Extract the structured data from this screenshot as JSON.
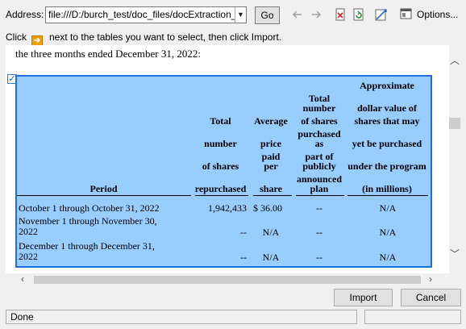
{
  "toolbar": {
    "address_label": "Address:",
    "address_value": "file:///D:/burch_test/doc_files/docExtraction_",
    "go_label": "Go",
    "options_label": "Options..."
  },
  "hint": {
    "before": "Click",
    "after": "next to the tables you want to select, then click Import."
  },
  "document": {
    "intro_text": "the three months ended December 31, 2022:",
    "table": {
      "headers": {
        "period": "Period",
        "total_shares": [
          "Total",
          "number",
          "of shares",
          "repurchased"
        ],
        "avg_price": [
          "Average",
          "price",
          "paid",
          "per",
          "share"
        ],
        "total_plan": [
          "Total",
          "number",
          "of shares",
          "purchased",
          "as",
          "part of",
          "publicly",
          "announced",
          "plan"
        ],
        "approx": [
          "Approximate",
          "dollar value of",
          "shares that may",
          "yet be purchased",
          "under the program",
          "(in millions)"
        ]
      },
      "rows": [
        {
          "period": "October 1 through October 31, 2022",
          "shares": "1,942,433",
          "price": "$ 36.00",
          "plan": "--",
          "approx": "N/A"
        },
        {
          "period_line1": "November 1 through November 30,",
          "period_line2": "2022",
          "shares": "--",
          "price": "N/A",
          "plan": "--",
          "approx": "N/A"
        },
        {
          "period_line1": "December 1 through December 31,",
          "period_line2": "2022",
          "shares": "--",
          "price": "N/A",
          "plan": "--",
          "approx": "N/A"
        }
      ]
    }
  },
  "buttons": {
    "import_label": "Import",
    "cancel_label": "Cancel"
  },
  "status": {
    "text": "Done"
  },
  "colors": {
    "table_selected_bg": "#99ccff",
    "table_selected_border": "#1e6fd9",
    "arrow_badge": "#f0a000"
  }
}
